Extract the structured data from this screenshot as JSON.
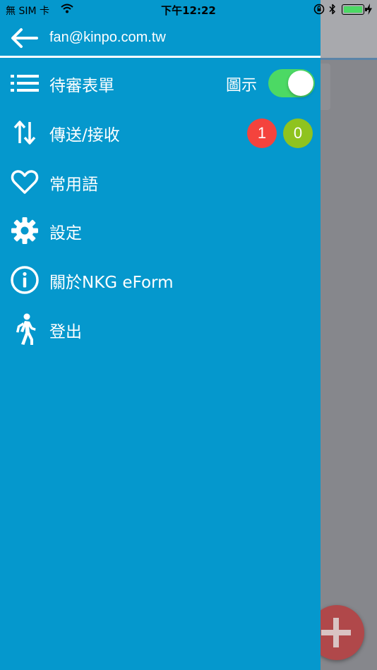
{
  "status_bar": {
    "carrier": "無 SIM 卡",
    "time": "下午12:22"
  },
  "header": {
    "user_email": "fan@kinpo.com.tw"
  },
  "menu": {
    "items": [
      {
        "label": "待審表單",
        "icon": "list-icon"
      },
      {
        "label": "傳送/接收",
        "icon": "sort-arrows-icon"
      },
      {
        "label": "常用語",
        "icon": "heart-icon"
      },
      {
        "label": "設定",
        "icon": "gear-icon"
      },
      {
        "label": "關於NKG eForm",
        "icon": "info-icon"
      },
      {
        "label": "登出",
        "icon": "walking-person-icon"
      }
    ]
  },
  "display_toggle": {
    "label": "圖示",
    "on": true
  },
  "badges": {
    "sent": "1",
    "received": "0"
  },
  "colors": {
    "drawer_bg": "#0598cd",
    "toggle_on": "#4cd964",
    "badge_red": "#f4433d",
    "badge_green": "#8fc31f",
    "fab": "#b0484a"
  }
}
